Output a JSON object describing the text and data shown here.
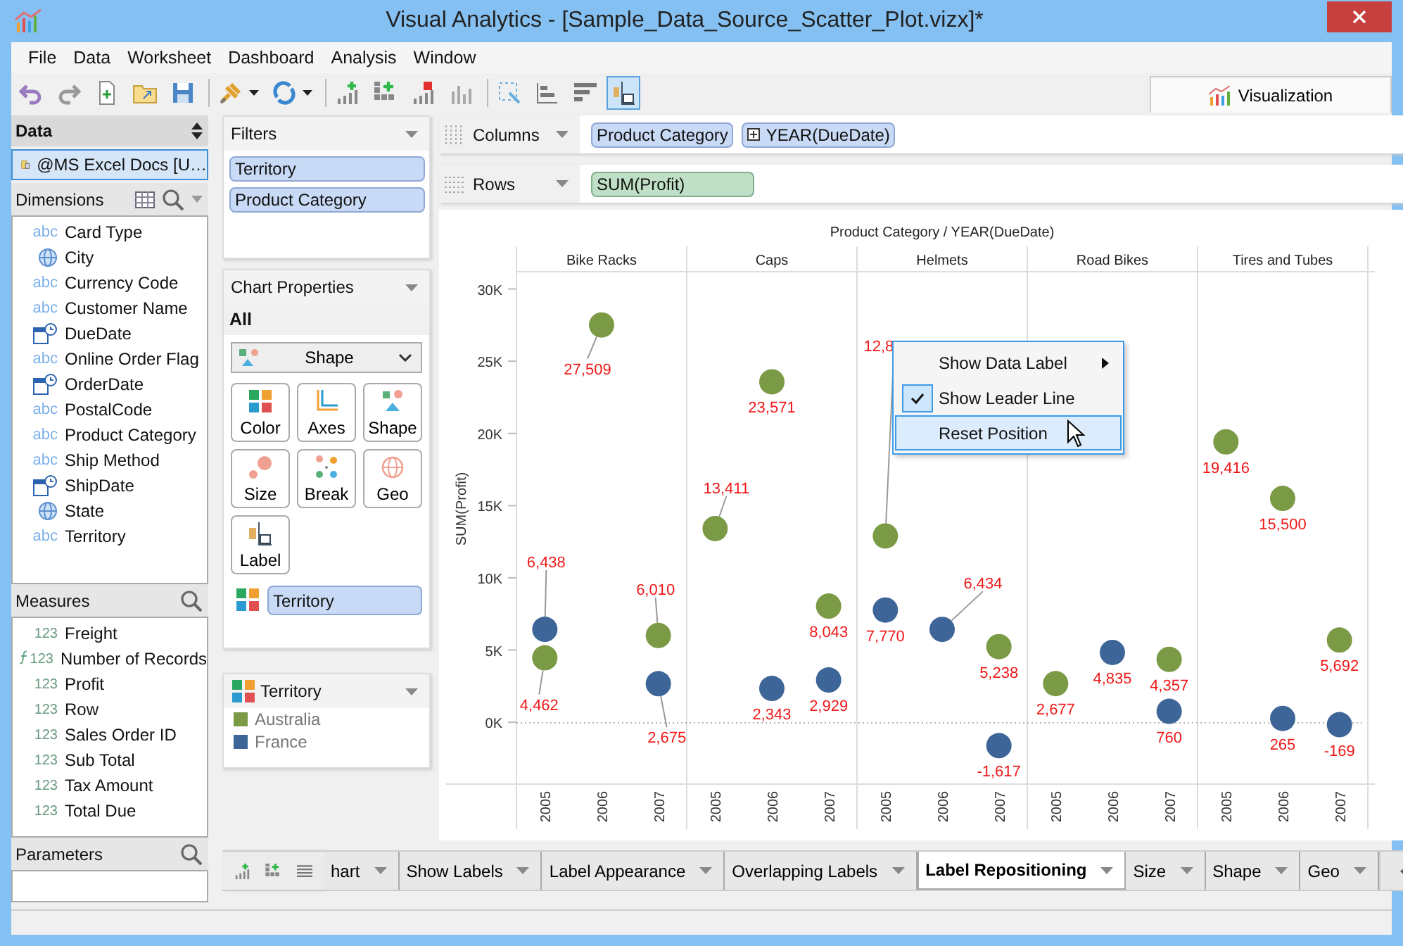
{
  "window": {
    "title": "Visual Analytics - [Sample_Data_Source_Scatter_Plot.vizx]*"
  },
  "menu": [
    "File",
    "Data",
    "Worksheet",
    "Dashboard",
    "Analysis",
    "Window"
  ],
  "toolbar": {
    "groups": [
      {
        "items": [
          {
            "kind": "undo",
            "selected": false,
            "dropdown": false
          },
          {
            "kind": "redo",
            "selected": false,
            "dropdown": false
          },
          {
            "kind": "new",
            "selected": false,
            "dropdown": false
          },
          {
            "kind": "open",
            "selected": false,
            "dropdown": false
          },
          {
            "kind": "save",
            "selected": false,
            "dropdown": false
          }
        ]
      },
      {
        "items": [
          {
            "kind": "connect",
            "selected": false,
            "dropdown": true
          },
          {
            "kind": "refresh",
            "selected": false,
            "dropdown": true
          }
        ]
      },
      {
        "items": [
          {
            "kind": "add-chart",
            "selected": false,
            "dropdown": false
          },
          {
            "kind": "add-grid",
            "selected": false,
            "dropdown": false
          },
          {
            "kind": "remove-chart",
            "selected": false,
            "dropdown": false
          },
          {
            "kind": "bar-chart",
            "selected": false,
            "dropdown": false
          }
        ]
      },
      {
        "items": [
          {
            "kind": "select",
            "selected": false,
            "dropdown": false
          },
          {
            "kind": "bars",
            "selected": false,
            "dropdown": false
          },
          {
            "kind": "sorted-bars",
            "selected": false,
            "dropdown": false
          },
          {
            "kind": "label",
            "selected": true,
            "dropdown": false
          }
        ]
      }
    ],
    "view_tab": {
      "label": "Visualization",
      "selected": true
    }
  },
  "data_panel": {
    "title": "Data",
    "source": "@MS Excel Docs [U…",
    "dimensions": {
      "title": "Dimensions",
      "items": [
        {
          "kind": "string",
          "badge": "abc",
          "name": "Card Type"
        },
        {
          "kind": "geo",
          "name": "City"
        },
        {
          "kind": "string",
          "badge": "abc",
          "name": "Currency Code"
        },
        {
          "kind": "string",
          "badge": "abc",
          "name": "Customer Name"
        },
        {
          "kind": "date",
          "name": "DueDate"
        },
        {
          "kind": "string",
          "badge": "abc",
          "name": "Online Order Flag"
        },
        {
          "kind": "date",
          "name": "OrderDate"
        },
        {
          "kind": "string",
          "badge": "abc",
          "name": "PostalCode"
        },
        {
          "kind": "string",
          "badge": "abc",
          "name": "Product Category"
        },
        {
          "kind": "string",
          "badge": "abc",
          "name": "Ship Method"
        },
        {
          "kind": "date",
          "name": "ShipDate"
        },
        {
          "kind": "geo",
          "name": "State"
        },
        {
          "kind": "string",
          "badge": "abc",
          "name": "Territory"
        }
      ]
    },
    "measures": {
      "title": "Measures",
      "items": [
        {
          "kind": "number",
          "badge": "123",
          "name": "Freight"
        },
        {
          "kind": "calc",
          "badge": "123",
          "name": "Number of Records"
        },
        {
          "kind": "number",
          "badge": "123",
          "name": "Profit"
        },
        {
          "kind": "number",
          "badge": "123",
          "name": "Row"
        },
        {
          "kind": "number",
          "badge": "123",
          "name": "Sales Order ID"
        },
        {
          "kind": "number",
          "badge": "123",
          "name": "Sub Total"
        },
        {
          "kind": "number",
          "badge": "123",
          "name": "Tax Amount"
        },
        {
          "kind": "number",
          "badge": "123",
          "name": "Total Due"
        }
      ]
    },
    "parameters": {
      "title": "Parameters"
    }
  },
  "filters": {
    "title": "Filters",
    "items": [
      "Territory",
      "Product Category"
    ]
  },
  "chart_properties": {
    "title": "Chart Properties",
    "level": "All",
    "mark_type": "Shape",
    "buttons": [
      {
        "kind": "color",
        "label": "Color"
      },
      {
        "kind": "axes",
        "label": "Axes"
      },
      {
        "kind": "shape",
        "label": "Shape"
      },
      {
        "kind": "size",
        "label": "Size"
      },
      {
        "kind": "break",
        "label": "Break"
      },
      {
        "kind": "geo",
        "label": "Geo"
      },
      {
        "kind": "label",
        "label": "Label"
      }
    ],
    "color_field": "Territory"
  },
  "legend": {
    "title": "Territory"
  },
  "shelves": [
    {
      "label": "Columns",
      "kind": "columns",
      "pills": [
        {
          "text": "Product Category",
          "kind": "dimension"
        },
        {
          "text": "YEAR(DueDate)",
          "kind": "date"
        }
      ]
    },
    {
      "label": "Rows",
      "kind": "rows",
      "pills": [
        {
          "text": "SUM(Profit)",
          "kind": "measure"
        }
      ]
    }
  ],
  "chart": {
    "panes": [
      "Bike Racks",
      "Caps",
      "Helmets",
      "Road Bikes",
      "Tires and Tubes"
    ],
    "chart_data": {
      "type": "scatter",
      "title": "Product Category / YEAR(DueDate)",
      "ylabel": "SUM(Profit)",
      "categories": [
        "2005",
        "2006",
        "2007",
        "2005",
        "2006",
        "2007",
        "2005",
        "2006",
        "2007",
        "2005",
        "2006",
        "2007",
        "2005",
        "2006",
        "2007"
      ],
      "ylim": [
        -7400,
        31100
      ],
      "annotations": [
        "12,8"
      ],
      "yticks": [
        {
          "value": 0,
          "label": "0K"
        },
        {
          "value": 5000,
          "label": "5K"
        },
        {
          "value": 10000,
          "label": "10K"
        },
        {
          "value": 15000,
          "label": "15K"
        },
        {
          "value": 20000,
          "label": "20K"
        },
        {
          "value": 25000,
          "label": "25K"
        },
        {
          "value": 30000,
          "label": "30K"
        }
      ],
      "series": [
        {
          "name": "Australia",
          "color": "#7b9a45",
          "values": [
            4462,
            27509,
            6010,
            13411,
            23571,
            8043,
            12900,
            null,
            5238,
            2677,
            null,
            4357,
            19416,
            15500,
            5692
          ],
          "value_labels": [
            "4,462",
            "27,509",
            "6,010",
            "13,411",
            "23,571",
            "8,043",
            null,
            null,
            "5,238",
            "2,677",
            null,
            "4,357",
            "19,416",
            "15,500",
            "5,692"
          ]
        },
        {
          "name": "France",
          "color": "#3e6598",
          "values": [
            6438,
            null,
            2675,
            null,
            2343,
            2929,
            7770,
            6434,
            -1617,
            null,
            4835,
            760,
            null,
            265,
            -169
          ],
          "value_labels": [
            "6,438",
            null,
            "2,675",
            null,
            "2,343",
            "2,929",
            "7,770",
            "6,434",
            "-1,617",
            null,
            "4,835",
            "760",
            null,
            "265",
            "-169"
          ]
        }
      ]
    }
  },
  "context_menu": {
    "items": [
      {
        "label": "Show Data Label",
        "submenu": true,
        "checked": false,
        "selected": false
      },
      {
        "label": "Show Leader Line",
        "submenu": false,
        "checked": true,
        "selected": false
      },
      {
        "label": "Reset Position",
        "submenu": false,
        "checked": false,
        "selected": true
      }
    ]
  },
  "sheet_tabs": [
    {
      "label": "hart",
      "selected": false
    },
    {
      "label": "Show Labels",
      "selected": false
    },
    {
      "label": "Label Appearance",
      "selected": false
    },
    {
      "label": "Overlapping Labels",
      "selected": false
    },
    {
      "label": "Label Repositioning",
      "selected": true
    },
    {
      "label": "Size",
      "selected": false
    },
    {
      "label": "Shape",
      "selected": false
    },
    {
      "label": "Geo",
      "selected": false
    }
  ]
}
